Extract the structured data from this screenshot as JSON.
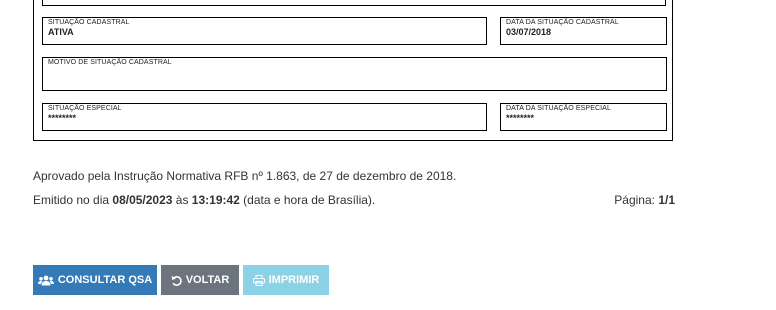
{
  "card": {
    "situacao_cadastral": {
      "label": "SITUAÇÃO CADASTRAL",
      "value": "ATIVA"
    },
    "data_situacao_cadastral": {
      "label": "DATA DA SITUAÇÃO CADASTRAL",
      "value": "03/07/2018"
    },
    "motivo": {
      "label": "MOTIVO DE SITUAÇÃO CADASTRAL",
      "value": ""
    },
    "situacao_especial": {
      "label": "SITUAÇÃO ESPECIAL",
      "value": "********"
    },
    "data_situacao_especial": {
      "label": "DATA DA SITUAÇÃO ESPECIAL",
      "value": "********"
    }
  },
  "footer": {
    "aprovado": "Aprovado pela Instrução Normativa RFB nº 1.863, de 27 de dezembro de 2018.",
    "emitido_prefix": "Emitido no dia ",
    "emitido_date": "08/05/2023",
    "emitido_mid": " às ",
    "emitido_time": "13:19:42",
    "emitido_suffix": " (data e hora de Brasília).",
    "pagina_label": "Página: ",
    "pagina_value": "1/1"
  },
  "buttons": {
    "consultar_qsa": "CONSULTAR QSA",
    "voltar": "VOLTAR",
    "imprimir": "IMPRIMIR"
  },
  "colors": {
    "primary": "#337ab7",
    "secondary": "#6c757d",
    "info": "#5bc0de"
  },
  "icons": {
    "consultar_qsa": "users-icon",
    "voltar": "undo-icon",
    "imprimir": "print-icon"
  }
}
